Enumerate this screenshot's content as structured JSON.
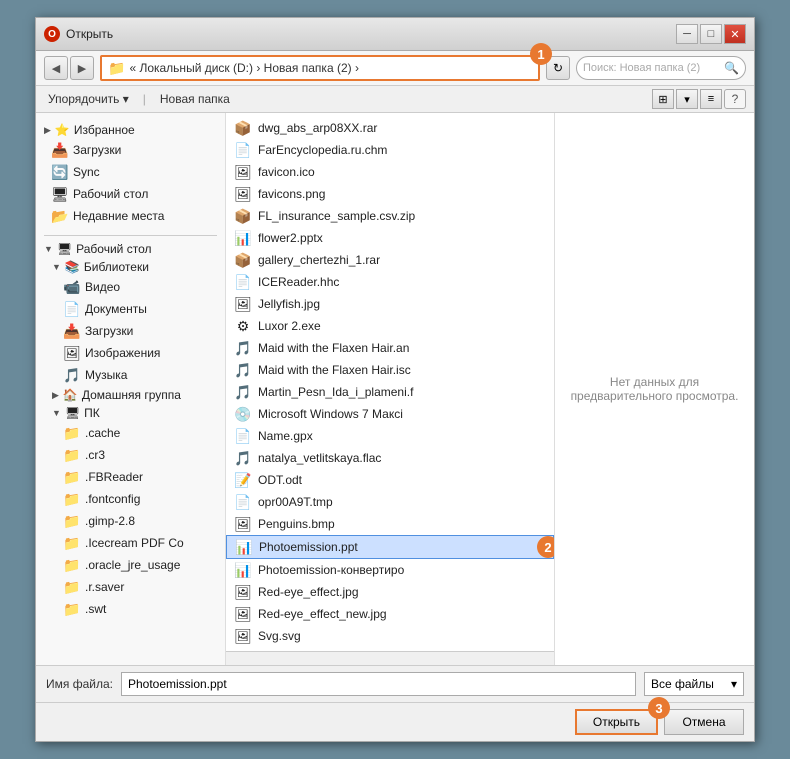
{
  "window": {
    "title": "Открыть",
    "close_btn": "✕",
    "min_btn": "─",
    "max_btn": "□"
  },
  "address_bar": {
    "icon": "◀",
    "path": "« Локальный диск (D:)  ›  Новая папка (2)  ›",
    "badge": "1"
  },
  "search": {
    "placeholder": "Поиск: Новая папка (2)"
  },
  "toolbar2": {
    "organize_label": "Упорядочить ▾",
    "new_folder_label": "Новая папка"
  },
  "sidebar": {
    "favorites_label": "Избранное",
    "items_favorites": [
      {
        "label": "Избранное",
        "icon": "⭐"
      },
      {
        "label": "Загрузки",
        "icon": "📥"
      },
      {
        "label": "Sync",
        "icon": "🔄"
      },
      {
        "label": "Рабочий стол",
        "icon": "🖥"
      },
      {
        "label": "Недавние места",
        "icon": "📂"
      }
    ],
    "desktop_label": "Рабочий стол",
    "libraries_label": "Библиотеки",
    "libraries_items": [
      {
        "label": "Видео",
        "icon": "📹"
      },
      {
        "label": "Документы",
        "icon": "📄"
      },
      {
        "label": "Загрузки",
        "icon": "📥"
      },
      {
        "label": "Изображения",
        "icon": "🖼"
      },
      {
        "label": "Музыка",
        "icon": "🎵"
      }
    ],
    "home_group_label": "Домашняя группа",
    "pc_label": "ПК",
    "tree_items": [
      {
        "label": ".cache",
        "indent": 3
      },
      {
        "label": ".cr3",
        "indent": 3
      },
      {
        "label": ".FBReader",
        "indent": 3
      },
      {
        "label": ".fontconfig",
        "indent": 3
      },
      {
        "label": ".gimp-2.8",
        "indent": 3
      },
      {
        "label": ".Icecream PDF Co",
        "indent": 3
      },
      {
        "label": ".oracle_jre_usage",
        "indent": 3
      },
      {
        "label": ".r.saver",
        "indent": 3
      },
      {
        "label": ".swt",
        "indent": 3
      }
    ]
  },
  "files": [
    {
      "name": "dwg_abs_arp08XX.rar",
      "icon": "📦"
    },
    {
      "name": "FarEncyclopedia.ru.chm",
      "icon": "📄"
    },
    {
      "name": "favicon.ico",
      "icon": "🖼"
    },
    {
      "name": "favicons.png",
      "icon": "🖼"
    },
    {
      "name": "FL_insurance_sample.csv.zip",
      "icon": "📦"
    },
    {
      "name": "flower2.pptx",
      "icon": "📊"
    },
    {
      "name": "gallery_chertezhi_1.rar",
      "icon": "📦"
    },
    {
      "name": "ICEReader.hhc",
      "icon": "📄"
    },
    {
      "name": "Jellyfish.jpg",
      "icon": "🖼"
    },
    {
      "name": "Luxor 2.exe",
      "icon": "⚙"
    },
    {
      "name": "Maid with the Flaxen Hair.an",
      "icon": "🎵"
    },
    {
      "name": "Maid with the Flaxen Hair.isc",
      "icon": "🎵"
    },
    {
      "name": "Martin_Pesn_Ida_i_plameni.f",
      "icon": "🎵"
    },
    {
      "name": "Microsoft Windows 7 Максi",
      "icon": "💿"
    },
    {
      "name": "Name.gpx",
      "icon": "📄"
    },
    {
      "name": "natalya_vetlitskaya.flac",
      "icon": "🎵"
    },
    {
      "name": "ODT.odt",
      "icon": "📝"
    },
    {
      "name": "opr00A9T.tmp",
      "icon": "📄"
    },
    {
      "name": "Penguins.bmp",
      "icon": "🖼"
    },
    {
      "name": "Photoemission.ppt",
      "icon": "📊",
      "selected": true
    },
    {
      "name": "Photoemission-конвертиро",
      "icon": "📊"
    },
    {
      "name": "Red-eye_effect.jpg",
      "icon": "🖼"
    },
    {
      "name": "Red-eye_effect_new.jpg",
      "icon": "🖼"
    },
    {
      "name": "Svg.svg",
      "icon": "🖼"
    }
  ],
  "preview": {
    "text": "Нет данных для предварительного просмотра."
  },
  "bottom": {
    "filename_label": "Имя файла:",
    "filename_value": "Photoemission.ppt",
    "filetype_value": "Все файлы",
    "open_label": "Открыть",
    "cancel_label": "Отмена",
    "badge3": "3"
  },
  "badges": {
    "badge1": "1",
    "badge2": "2",
    "badge3": "3"
  }
}
